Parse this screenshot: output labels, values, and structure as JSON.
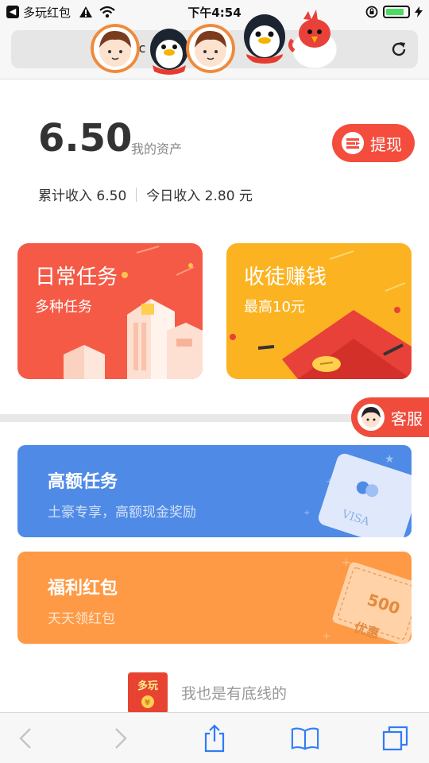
{
  "status_bar": {
    "app_back_label": "多玩红包",
    "time": "下午4:54",
    "battery_level": 0.85
  },
  "address_bar": {
    "url_text": "ic  pa   o"
  },
  "assets": {
    "balance": "6.50",
    "balance_label": "我的资产",
    "withdraw_label": "提现",
    "total_income": "累计收入 6.50",
    "today_income": "今日收入 2.80 元"
  },
  "cards": {
    "daily": {
      "title": "日常任务",
      "subtitle": "多种任务"
    },
    "invite": {
      "title": "收徒赚钱",
      "subtitle": "最高10元"
    }
  },
  "customer_service": {
    "label": "客服"
  },
  "banners": {
    "high": {
      "title": "高额任务",
      "subtitle": "土豪专享，高额现金奖励",
      "card_text": "VISA"
    },
    "welfare": {
      "title": "福利红包",
      "subtitle": "天天领红包",
      "coupon_amount": "500",
      "coupon_text": "优惠"
    }
  },
  "footer": {
    "logo_text": "多玩",
    "tagline": "我也是有底线的"
  },
  "colors": {
    "accent_red": "#f44d3d",
    "daily_card": "#f55a46",
    "invite_card": "#fbb322",
    "high_banner": "#4f8ae6",
    "welfare_banner": "#fe9a45"
  }
}
